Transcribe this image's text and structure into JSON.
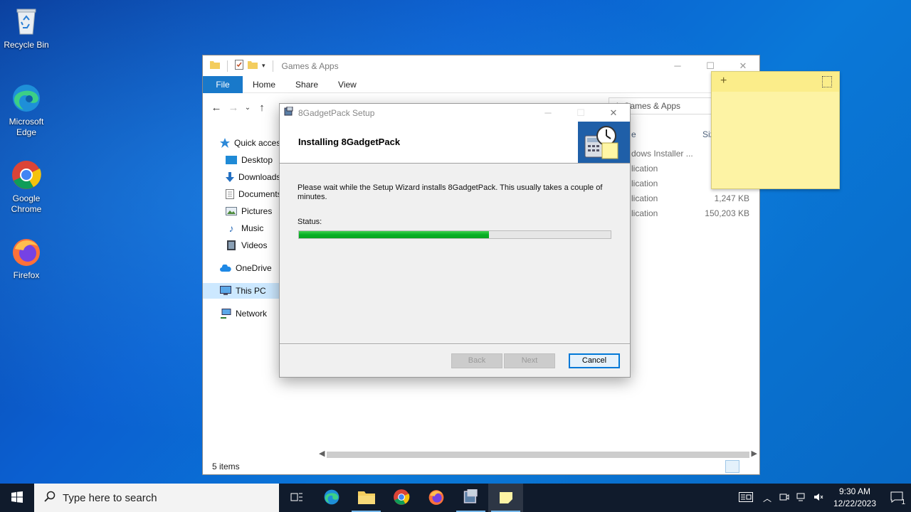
{
  "desktop": {
    "icons": [
      {
        "label": "Recycle Bin"
      },
      {
        "label": "Microsoft Edge"
      },
      {
        "label": "Google Chrome"
      },
      {
        "label": "Firefox"
      }
    ]
  },
  "explorer": {
    "title": "Games & Apps",
    "ribbon_tabs": [
      "File",
      "Home",
      "Share",
      "View"
    ],
    "search_placeholder": "ch Games & Apps",
    "nav": [
      "Quick access",
      "Desktop",
      "Downloads",
      "Documents",
      "Pictures",
      "Music",
      "Videos",
      "OneDrive",
      "This PC",
      "Network"
    ],
    "columns": {
      "type": "e",
      "size": "Siz"
    },
    "rows": [
      {
        "type": "dows Installer ...",
        "size": ""
      },
      {
        "type": "lication",
        "size": ""
      },
      {
        "type": "lication",
        "size": ""
      },
      {
        "type": "lication",
        "size": "1,247 KB"
      },
      {
        "type": "lication",
        "size": "150,203 KB"
      }
    ],
    "status": "5 items"
  },
  "dialog": {
    "title": "8GadgetPack Setup",
    "heading": "Installing 8GadgetPack",
    "description": "Please wait while the Setup Wizard installs 8GadgetPack. This usually takes a couple of minutes.",
    "status_label": "Status:",
    "progress": 0.61,
    "buttons": {
      "back": "Back",
      "next": "Next",
      "cancel": "Cancel"
    }
  },
  "sticky": {
    "plus": "+"
  },
  "taskbar": {
    "search_placeholder": "Type here to search",
    "time": "9:30 AM",
    "date": "12/22/2023",
    "notification_count": "1"
  },
  "colors": {
    "accent": "#0078d7",
    "progress": "#06b025",
    "sticky": "#fdf3a4",
    "taskbar": "#101b2c"
  }
}
